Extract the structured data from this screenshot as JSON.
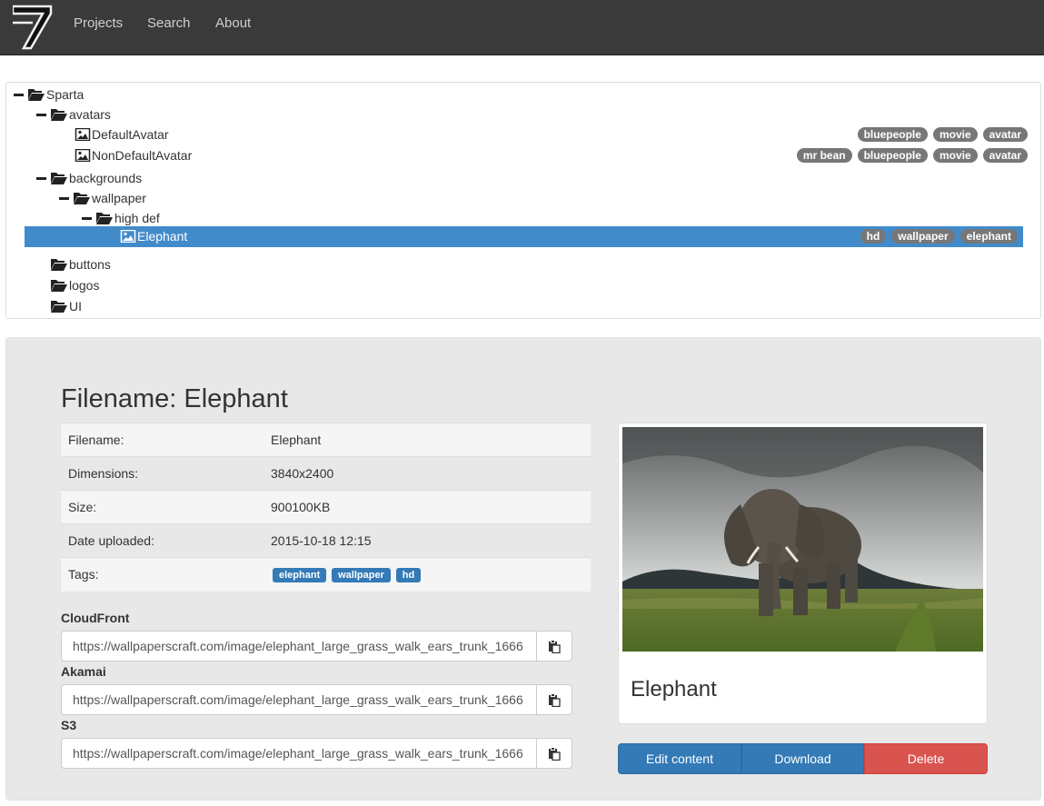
{
  "nav": {
    "links": [
      "Projects",
      "Search",
      "About"
    ]
  },
  "tree": {
    "rows": [
      {
        "label": "Sparta",
        "type": "folder-open",
        "tags": []
      },
      {
        "label": "avatars",
        "type": "folder-open",
        "tags": []
      },
      {
        "label": "DefaultAvatar",
        "type": "image",
        "tags": [
          "bluepeople",
          "movie",
          "avatar"
        ]
      },
      {
        "label": "NonDefaultAvatar",
        "type": "image",
        "tags": [
          "mr bean",
          "bluepeople",
          "movie",
          "avatar"
        ]
      },
      {
        "label": "backgrounds",
        "type": "folder-open",
        "tags": []
      },
      {
        "label": "wallpaper",
        "type": "folder-open",
        "tags": []
      },
      {
        "label": "high def",
        "type": "folder-open",
        "tags": []
      },
      {
        "label": "Elephant",
        "type": "image",
        "tags": [
          "hd",
          "wallpaper",
          "elephant"
        ],
        "selected": true
      },
      {
        "label": "buttons",
        "type": "folder",
        "tags": []
      },
      {
        "label": "logos",
        "type": "folder",
        "tags": []
      },
      {
        "label": "UI",
        "type": "folder",
        "tags": []
      }
    ]
  },
  "details": {
    "title": "Filename: Elephant",
    "fields": [
      {
        "key": "Filename:",
        "value": "Elephant"
      },
      {
        "key": "Dimensions:",
        "value": "3840x2400"
      },
      {
        "key": "Size:",
        "value": "900100KB"
      },
      {
        "key": "Date uploaded:",
        "value": "2015-10-18 12:15"
      },
      {
        "key": "Tags:",
        "value": ""
      }
    ],
    "tags": [
      "elephant",
      "wallpaper",
      "hd"
    ],
    "cdn": [
      {
        "label": "CloudFront",
        "url": "https://wallpaperscraft.com/image/elephant_large_grass_walk_ears_trunk_1666"
      },
      {
        "label": "Akamai",
        "url": "https://wallpaperscraft.com/image/elephant_large_grass_walk_ears_trunk_1666"
      },
      {
        "label": "S3",
        "url": "https://wallpaperscraft.com/image/elephant_large_grass_walk_ears_trunk_1666"
      }
    ],
    "caption": "Elephant",
    "actions": {
      "edit": "Edit content",
      "download": "Download",
      "delete": "Delete"
    }
  },
  "colors": {
    "navbar": "#3a3a3a",
    "selected_row": "#428bca",
    "tag_gray": "#777777",
    "badge_blue": "#337ab7",
    "primary": "#337ab7",
    "danger": "#d9534f"
  }
}
